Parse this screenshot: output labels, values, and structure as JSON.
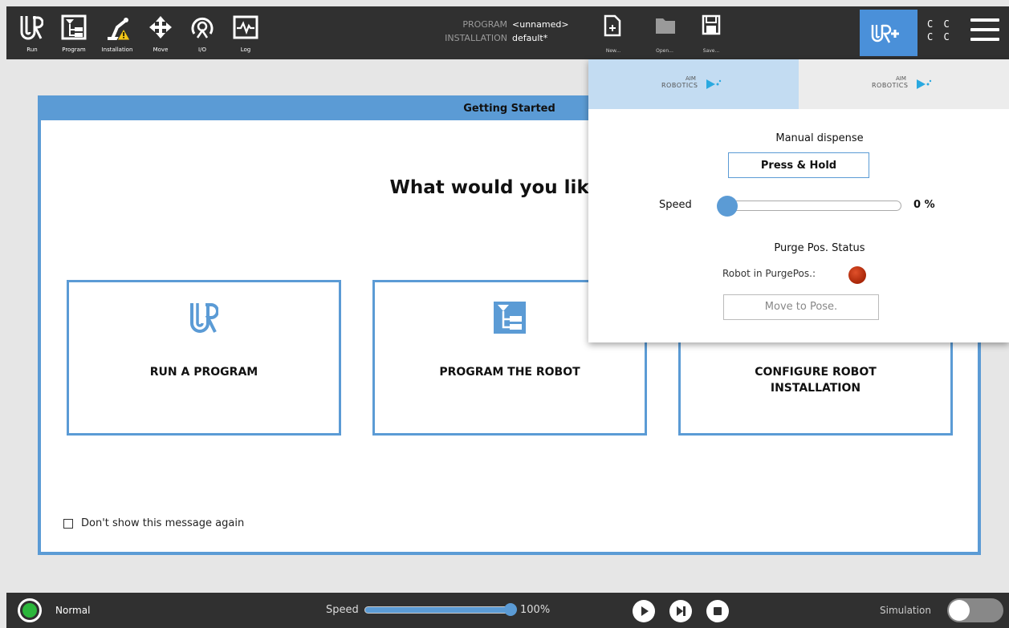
{
  "toolbar": {
    "items": [
      {
        "label": "Run",
        "icon": "ur-logo-icon"
      },
      {
        "label": "Program",
        "icon": "program-tree-icon"
      },
      {
        "label": "Installation",
        "icon": "robot-arm-warning-icon"
      },
      {
        "label": "Move",
        "icon": "move-arrows-icon"
      },
      {
        "label": "I/O",
        "icon": "io-icon"
      },
      {
        "label": "Log",
        "icon": "log-graph-icon"
      }
    ],
    "program_key": "PROGRAM",
    "program_value": "<unnamed>",
    "installation_key": "INSTALLATION",
    "installation_value": "default*",
    "new_label": "New...",
    "open_label": "Open...",
    "save_label": "Save...",
    "cc_line1": "C C",
    "cc_line2": "C C"
  },
  "dialog": {
    "title": "Getting Started",
    "question": "What would you like to",
    "cards": [
      {
        "label": "RUN A PROGRAM",
        "icon": "ur-logo-icon"
      },
      {
        "label": "PROGRAM THE ROBOT",
        "icon": "program-tree-icon"
      },
      {
        "label": "CONFIGURE ROBOT INSTALLATION",
        "icon": "installation-icon"
      }
    ],
    "dont_show": "Don't show this message again"
  },
  "panel": {
    "tabs": [
      {
        "brand_top": "AIM",
        "brand_bottom": "ROBOTICS",
        "active": true
      },
      {
        "brand_top": "AIM",
        "brand_bottom": "ROBOTICS",
        "active": false
      }
    ],
    "manual_title": "Manual dispense",
    "press_hold": "Press & Hold",
    "speed_label": "Speed",
    "speed_value": "0 %",
    "speed_fraction": 0.0,
    "purge_title": "Purge Pos. Status",
    "purge_label": "Robot in PurgePos.:",
    "purge_status_color": "#c0300f",
    "move_pose": "Move to Pose."
  },
  "bottombar": {
    "status": "Normal",
    "status_color": "#2bb63b",
    "speed_label": "Speed",
    "speed_value": "100%",
    "speed_fraction": 1.0,
    "simulation_label": "Simulation",
    "simulation_on": false
  },
  "colors": {
    "accent": "#5b9bd5",
    "bar": "#303030",
    "tab_active": "#c3dcf2"
  }
}
